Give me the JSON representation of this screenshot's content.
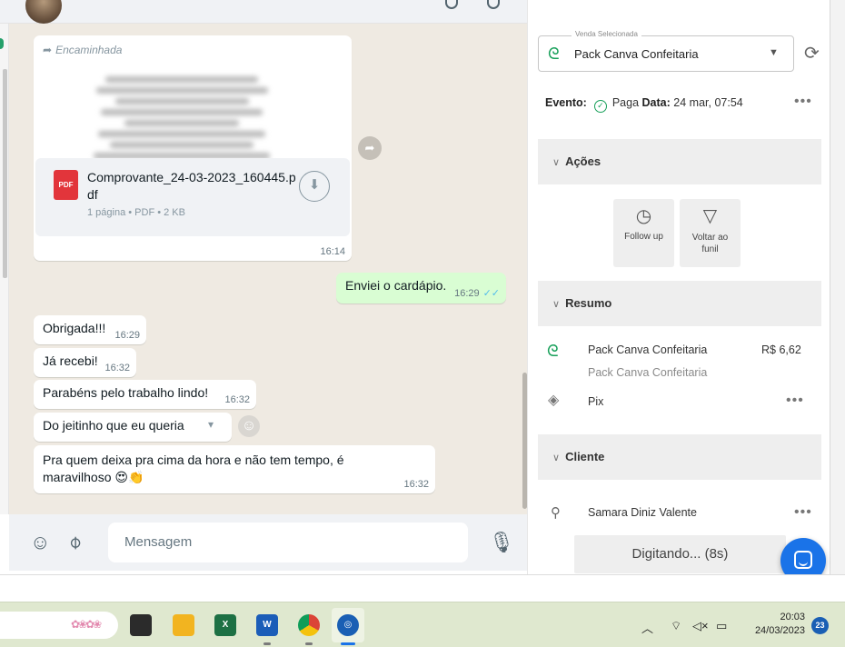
{
  "chat": {
    "forwarded_label": "Encaminhada",
    "document": {
      "name": "Comprovante_24-03-2023_160445.pdf",
      "meta": "1 página • PDF • 2 KB",
      "time": "16:14"
    },
    "messages": [
      {
        "direction": "out",
        "text": "Enviei o cardápio.",
        "time": "16:29",
        "status": "read"
      },
      {
        "direction": "in",
        "text": "Obrigada!!!",
        "time": "16:29"
      },
      {
        "direction": "in",
        "text": "Já recebi!",
        "time": "16:32"
      },
      {
        "direction": "in",
        "text": "Parabéns pelo trabalho lindo!",
        "time": "16:32"
      },
      {
        "direction": "in",
        "text": "Do jeitinho que eu queria",
        "time": ""
      },
      {
        "direction": "in",
        "text": "Pra quem deixa pra cima da hora e não tem tempo, é maravilhoso 😍👏",
        "time": "16:32"
      }
    ]
  },
  "composer": {
    "placeholder": "Mensagem"
  },
  "panel": {
    "venda_label": "Venda Selecionada",
    "venda_value": "Pack Canva Confeitaria",
    "evento_label": "Evento:",
    "evento_status": "Paga",
    "data_label": "Data:",
    "data_value": "24 mar, 07:54",
    "sections": {
      "acoes": "Ações",
      "resumo": "Resumo",
      "cliente": "Cliente"
    },
    "actions": [
      {
        "label": "Follow up",
        "icon": "clock-icon"
      },
      {
        "label": "Voltar ao funil",
        "icon": "funnel-icon"
      }
    ],
    "resumo": {
      "product": "Pack Canva Confeitaria",
      "price": "R$ 6,62",
      "subtitle": "Pack Canva Confeitaria",
      "payment": "Pix"
    },
    "cliente": {
      "name": "Samara Diniz Valente"
    },
    "typing": "Digitando... (8s)"
  },
  "taskbar": {
    "time": "20:03",
    "date": "24/03/2023",
    "notifications": "23",
    "apps": [
      "file-icon",
      "file-explorer-icon",
      "excel-icon",
      "word-icon",
      "chrome-icon",
      "app-icon"
    ]
  },
  "colors": {
    "chat_bg": "#efeae2",
    "outgoing_bubble": "#d9fdd3",
    "brand_green": "#18a05a",
    "taskbar_bg": "#dfe8cf",
    "fab_blue": "#1a73e8"
  }
}
